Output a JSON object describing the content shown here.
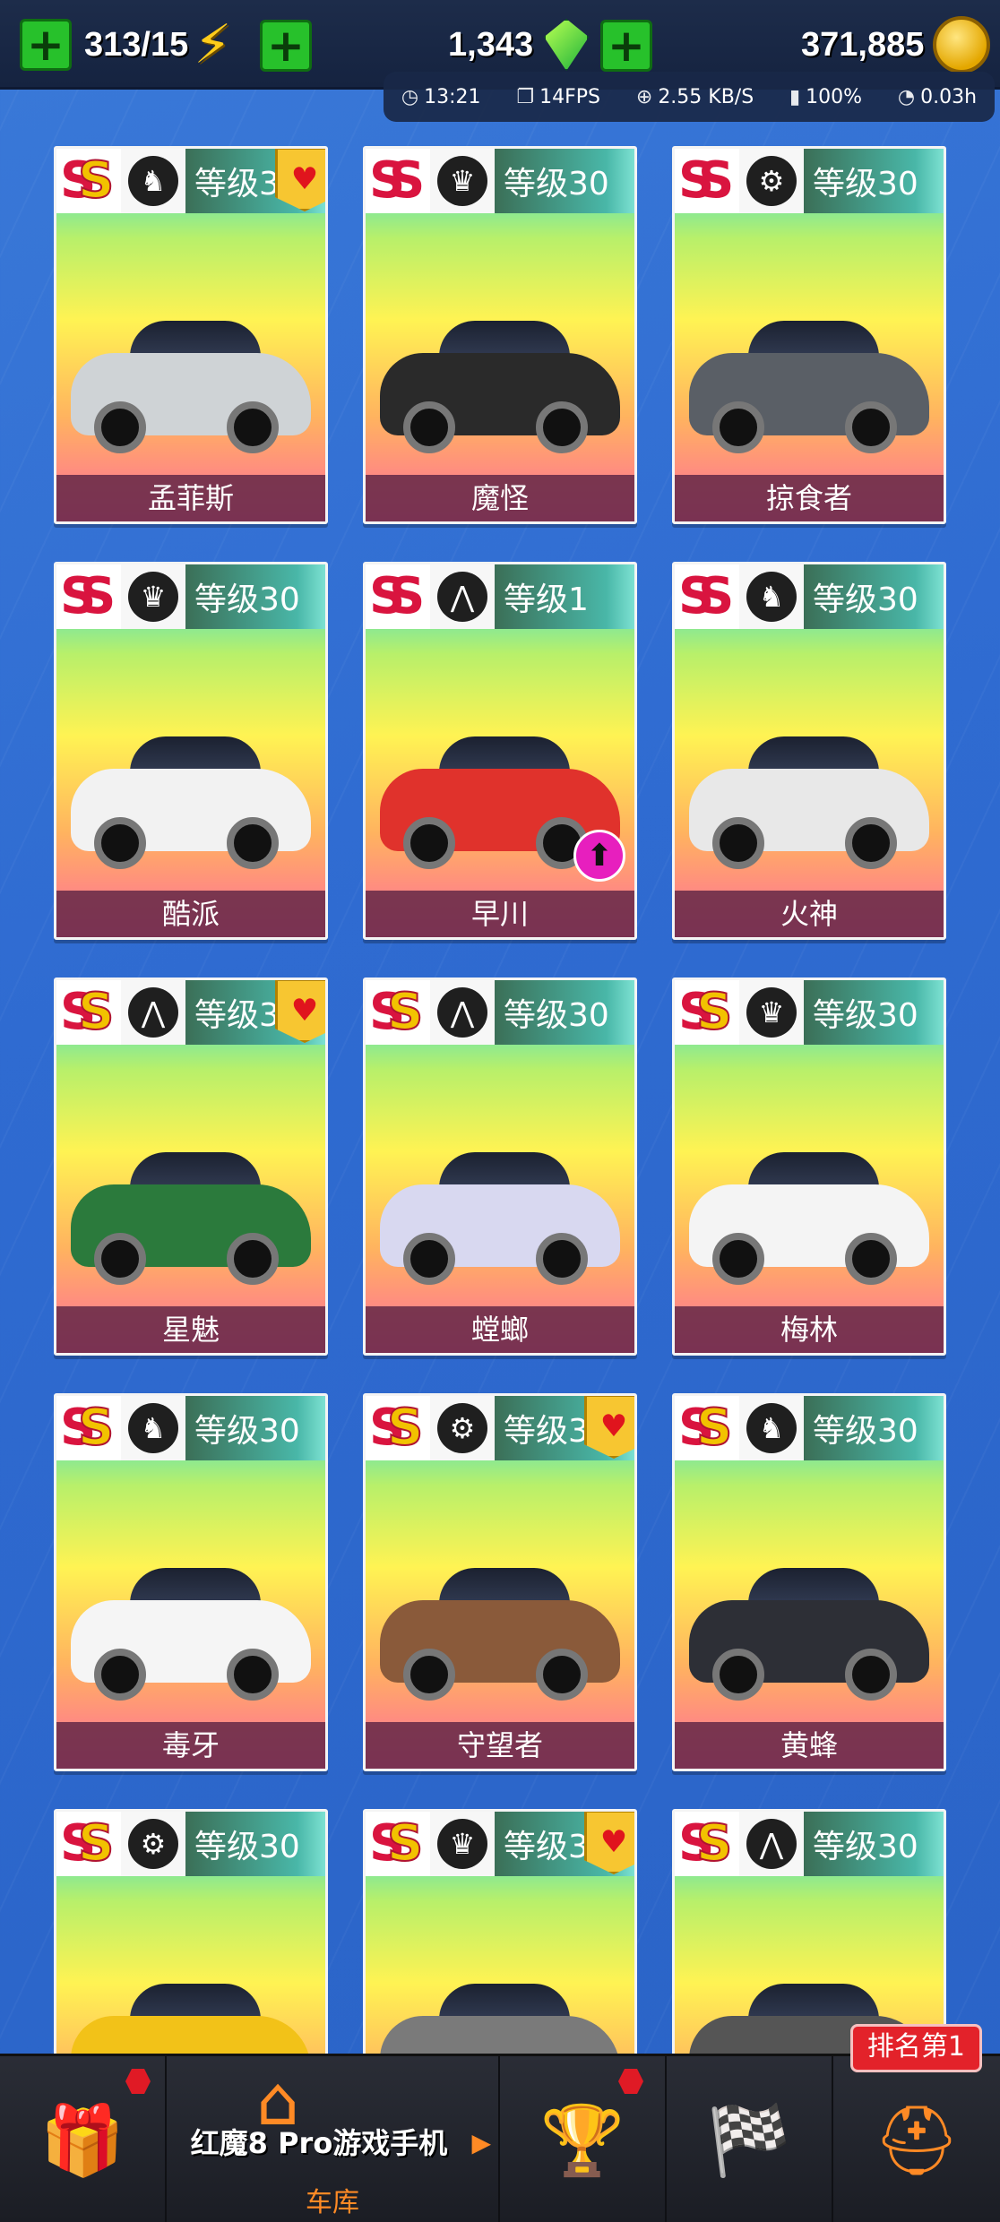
{
  "currencies": {
    "energy": "313/15",
    "gems": "1,343",
    "coins": "371,885"
  },
  "status": {
    "time": "13:21",
    "fps": "14FPS",
    "net": "2.55 KB/S",
    "battery": "100%",
    "runtime": "0.03h"
  },
  "cards": [
    {
      "rank": "SS",
      "class_icon": "horse-icon",
      "level": "等级30",
      "name": "孟菲斯",
      "favorite": true,
      "upgrade": false,
      "color": "#cfd3d6"
    },
    {
      "rank": "S",
      "class_icon": "crown-icon",
      "level": "等级30",
      "name": "魔怪",
      "favorite": false,
      "upgrade": false,
      "color": "#2a2a2a"
    },
    {
      "rank": "S",
      "class_icon": "tire-icon",
      "level": "等级30",
      "name": "掠食者",
      "favorite": false,
      "upgrade": false,
      "color": "#5a5f66"
    },
    {
      "rank": "S",
      "class_icon": "crown-icon",
      "level": "等级30",
      "name": "酷派",
      "favorite": false,
      "upgrade": false,
      "color": "#f2f2f2"
    },
    {
      "rank": "S",
      "class_icon": "road-icon",
      "level": "等级1",
      "name": "早川",
      "favorite": false,
      "upgrade": true,
      "color": "#e0322c"
    },
    {
      "rank": "S",
      "class_icon": "horse-icon",
      "level": "等级30",
      "name": "火神",
      "favorite": false,
      "upgrade": false,
      "color": "#e8e8e8"
    },
    {
      "rank": "SS",
      "class_icon": "road-icon",
      "level": "等级30",
      "name": "星魅",
      "favorite": true,
      "upgrade": false,
      "color": "#2b7a3c"
    },
    {
      "rank": "SS",
      "class_icon": "road-icon",
      "level": "等级30",
      "name": "螳螂",
      "favorite": false,
      "upgrade": false,
      "color": "#d8d8f0"
    },
    {
      "rank": "SS",
      "class_icon": "crown-icon",
      "level": "等级30",
      "name": "梅林",
      "favorite": false,
      "upgrade": false,
      "color": "#f4f4f4"
    },
    {
      "rank": "SS",
      "class_icon": "horse-icon",
      "level": "等级30",
      "name": "毒牙",
      "favorite": false,
      "upgrade": false,
      "color": "#f5f5f5"
    },
    {
      "rank": "SS",
      "class_icon": "tire-icon",
      "level": "等级30",
      "name": "守望者",
      "favorite": true,
      "upgrade": false,
      "color": "#8a5a3a"
    },
    {
      "rank": "SS",
      "class_icon": "horse-icon",
      "level": "等级30",
      "name": "黄蜂",
      "favorite": false,
      "upgrade": false,
      "color": "#2d2f36"
    },
    {
      "rank": "SS",
      "class_icon": "tire-icon",
      "level": "等级30",
      "name": "",
      "favorite": false,
      "upgrade": false,
      "color": "#f2c218"
    },
    {
      "rank": "SS",
      "class_icon": "crown-icon",
      "level": "等级30",
      "name": "",
      "favorite": true,
      "upgrade": false,
      "color": "#7a7a7a"
    },
    {
      "rank": "SS",
      "class_icon": "road-icon",
      "level": "等级30",
      "name": "",
      "favorite": false,
      "upgrade": false,
      "color": "#555"
    }
  ],
  "nav": {
    "promo_text": "红魔8 Pro游戏手机",
    "garage_label": "车库",
    "rank_badge": "排名第1"
  }
}
